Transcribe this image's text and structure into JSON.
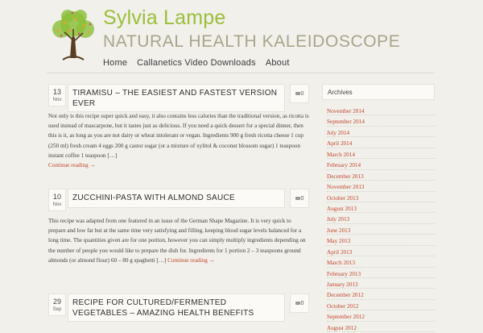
{
  "site": {
    "name": "Sylvia Lampe",
    "tagline": "NATURAL HEALTH KALEIDOSCOPE"
  },
  "nav": {
    "items": [
      "Home",
      "Callanetics Video Downloads",
      "About"
    ]
  },
  "posts": [
    {
      "day": "13",
      "month": "Nov",
      "title": "TIRAMISU – THE EASIEST AND FASTEST VERSION EVER",
      "comments": "0",
      "excerpt": "Not only is this recipe super quick and easy, it also contains less calories than the traditional version, as ricotta is used instead of mascarpone, but it tastes just as delicious. If you need a quick dessert for a special dinner, then this is it, as long as you are not dairy or wheat intolerant or vegan. Ingredients 900 g fresh ricotta cheese 1 cup (250 ml) fresh cream 4 eggs 200 g castor sugar (or a mixture of xylitol & coconut blossom sugar) 1 teaspoon instant coffee 1 teaspoon […]",
      "more": "Continue reading →"
    },
    {
      "day": "10",
      "month": "Nov",
      "title": "ZUCCHINI-PASTA WITH ALMOND SAUCE",
      "comments": "0",
      "excerpt": "This recipe was adapted from one featured in an issue of the German Shape Magazine. It is very quick to prepare and low fat but at the same time very satisfying and filling, keeping blood sugar levels balanced for a long time. The quantities given are for one portion, however you can simply multiply ingredients depending on the number of people you would like to prepare the dish for. Ingredients for 1 portion 2 – 3 teaspoons ground almonds (or almond flour) 60 – 80 g spaghetti […]",
      "more": "Continue reading →"
    },
    {
      "day": "29",
      "month": "Sep",
      "title": "RECIPE FOR CULTURED/FERMENTED VEGETABLES – AMAZING HEALTH BENEFITS",
      "comments": "0"
    }
  ],
  "sidebar": {
    "title": "Archives",
    "archives": [
      "November 2014",
      "September 2014",
      "July 2014",
      "April 2014",
      "March 2014",
      "February 2014",
      "December 2013",
      "November 2013",
      "October 2013",
      "August 2013",
      "July 2013",
      "June 2013",
      "May 2013",
      "April 2013",
      "March 2013",
      "February 2013",
      "January 2013",
      "December 2012",
      "October 2012",
      "September 2012",
      "August 2012"
    ]
  },
  "colors": {
    "background": "#f1f0eb",
    "title_green": "#9bbf3a",
    "link_red": "#c1432b"
  }
}
